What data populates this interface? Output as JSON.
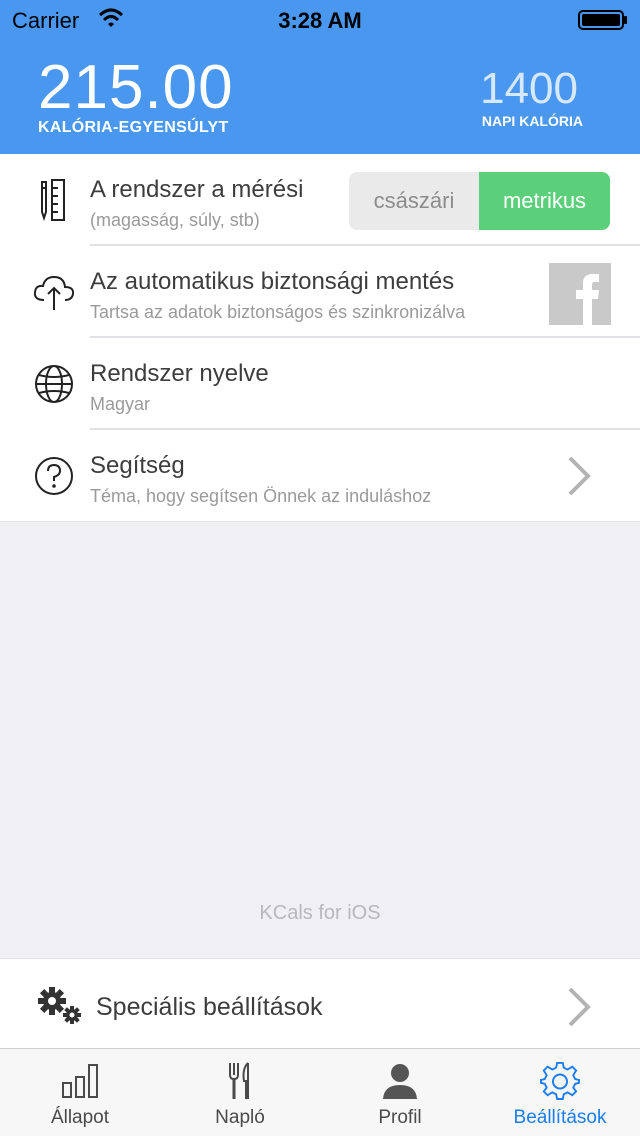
{
  "status_bar": {
    "carrier": "Carrier",
    "time": "3:28 AM"
  },
  "header": {
    "balance_value": "215.00",
    "balance_label": "KALÓRIA-EGYENSÚLYT",
    "daily_value": "1400",
    "daily_label": "NAPI KALÓRIA"
  },
  "settings": {
    "units": {
      "title": "A rendszer a mérési",
      "subtitle": "(magasság, súly, stb)",
      "option_imperial": "császári",
      "option_metric": "metrikus",
      "selected": "metrikus"
    },
    "backup": {
      "title": "Az automatikus biztonsági mentés",
      "subtitle": "Tartsa az adatok biztonságos és szinkronizálva"
    },
    "language": {
      "title": "Rendszer nyelve",
      "subtitle": "Magyar"
    },
    "help": {
      "title": "Segítség",
      "subtitle": "Téma, hogy segítsen Önnek az induláshoz"
    }
  },
  "footer_note": "KCals for iOS",
  "special_settings": {
    "label": "Speciális beállítások"
  },
  "tabs": [
    {
      "label": "Állapot",
      "icon": "bar-chart-icon",
      "active": false
    },
    {
      "label": "Napló",
      "icon": "fork-knife-icon",
      "active": false
    },
    {
      "label": "Profil",
      "icon": "person-icon",
      "active": false
    },
    {
      "label": "Beállítások",
      "icon": "gear-icon",
      "active": true
    }
  ],
  "colors": {
    "header_bg": "#4a97f0",
    "metric_selected": "#5ccf7a",
    "active_tab": "#1a7ef0"
  }
}
